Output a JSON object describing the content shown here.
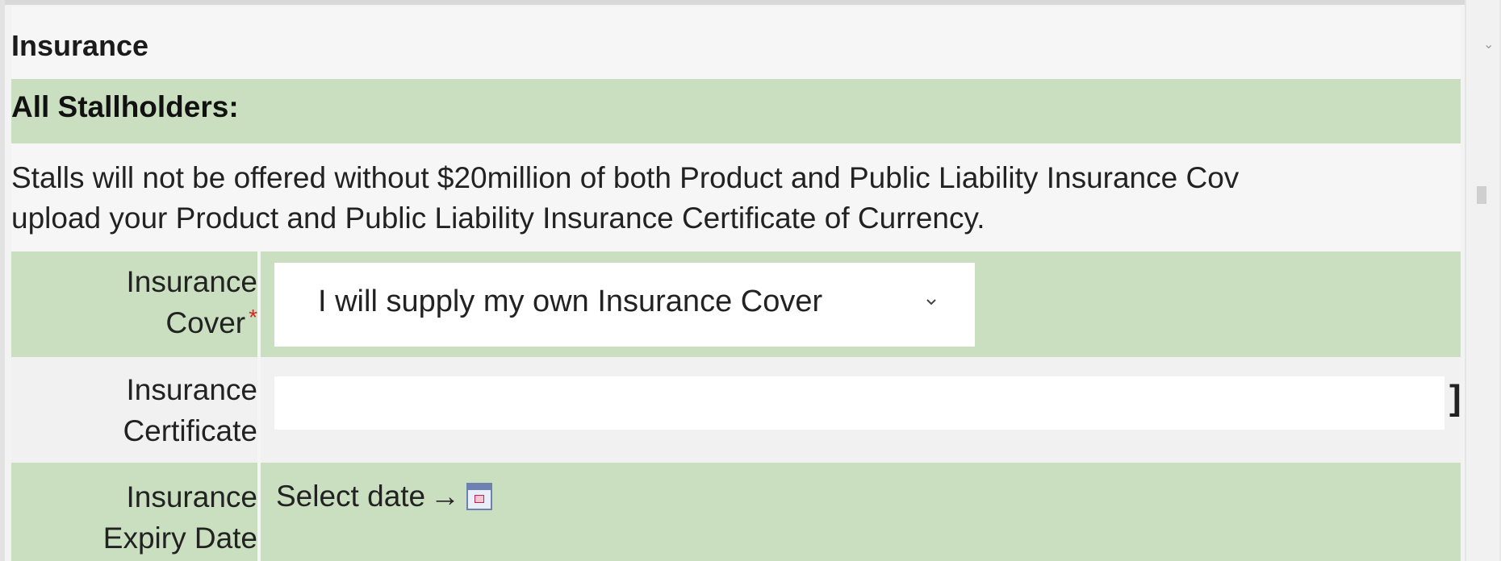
{
  "section": {
    "title": "Insurance"
  },
  "group": {
    "title": "All Stallholders:"
  },
  "notice": {
    "line1": "Stalls will not be offered without $20million of both Product and Public Liability Insurance Cov",
    "line2": "upload your Product and Public Liability Insurance Certificate of Currency."
  },
  "fields": {
    "cover": {
      "label_line1": "Insurance",
      "label_line2": "Cover",
      "required_marker": "*",
      "selected_value": "I will supply my own Insurance Cover",
      "icon": "chevron-down-icon"
    },
    "certificate": {
      "label_line1": "Insurance",
      "label_line2": "Certificate",
      "value": "",
      "trailing_mark": "]"
    },
    "expiry": {
      "label_line1": "Insurance",
      "label_line2": "Expiry Date",
      "select_text": "Select date",
      "arrow": "→",
      "icon": "calendar-icon"
    }
  },
  "colors": {
    "row_green": "#c9dfc0",
    "row_gray": "#f1f1f1",
    "required": "#dd2222"
  }
}
